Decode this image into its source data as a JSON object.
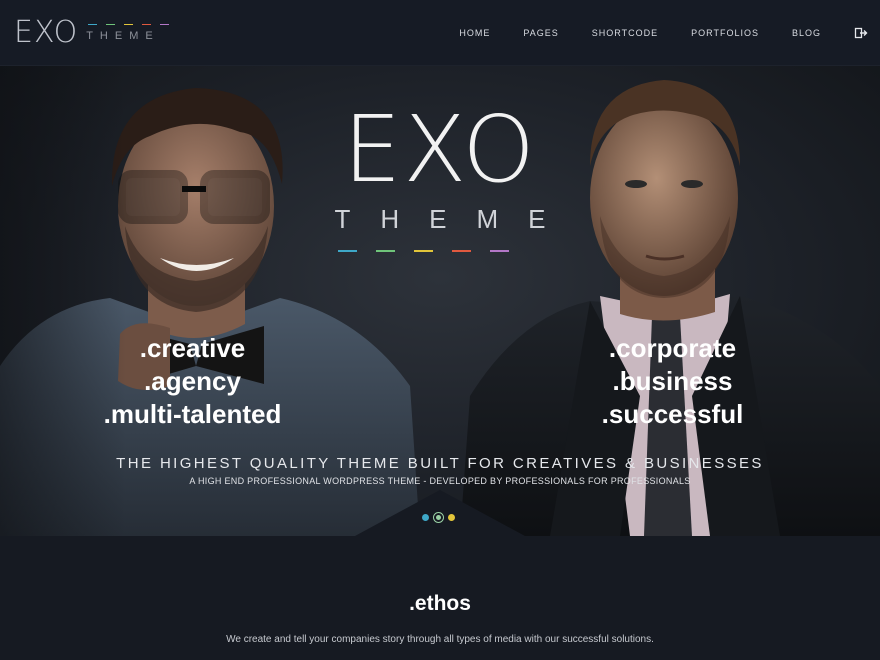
{
  "header": {
    "logo_main": "EXO",
    "logo_sub": "THEME",
    "logo_bar_colors": [
      "#3ea8c8",
      "#6fc47a",
      "#e2c53a",
      "#e0593f",
      "#b377c7"
    ],
    "nav": [
      {
        "label": "HOME"
      },
      {
        "label": "PAGES"
      },
      {
        "label": "SHORTCODE"
      },
      {
        "label": "PORTFOLIOS"
      },
      {
        "label": "BLOG"
      }
    ],
    "exit_icon": "sign-out-icon"
  },
  "hero": {
    "logo_main": "EXO",
    "logo_sub": "THEME",
    "bar_colors": [
      "#3ea8c8",
      "#6fc47a",
      "#e2c53a",
      "#e0593f",
      "#b377c7"
    ],
    "left_tags": [
      ".creative",
      ".agency",
      ".multi-talented"
    ],
    "right_tags": [
      ".corporate",
      ".business",
      ".successful"
    ],
    "headline": "THE HIGHEST QUALITY THEME BUILT FOR CREATIVES & BUSINESSES",
    "subline": "A HIGH END PROFESSIONAL WORDPRESS THEME - DEVELOPED BY PROFESSIONALS FOR PROFESSIONALS",
    "slider_dots": [
      {
        "color": "#3ea8c8"
      },
      {
        "color": "#9ad1a5",
        "active": true
      },
      {
        "color": "#e2c53a"
      }
    ]
  },
  "ethos": {
    "title": ".ethos",
    "text": "We create and tell your companies story through all types of media with our successful solutions."
  }
}
